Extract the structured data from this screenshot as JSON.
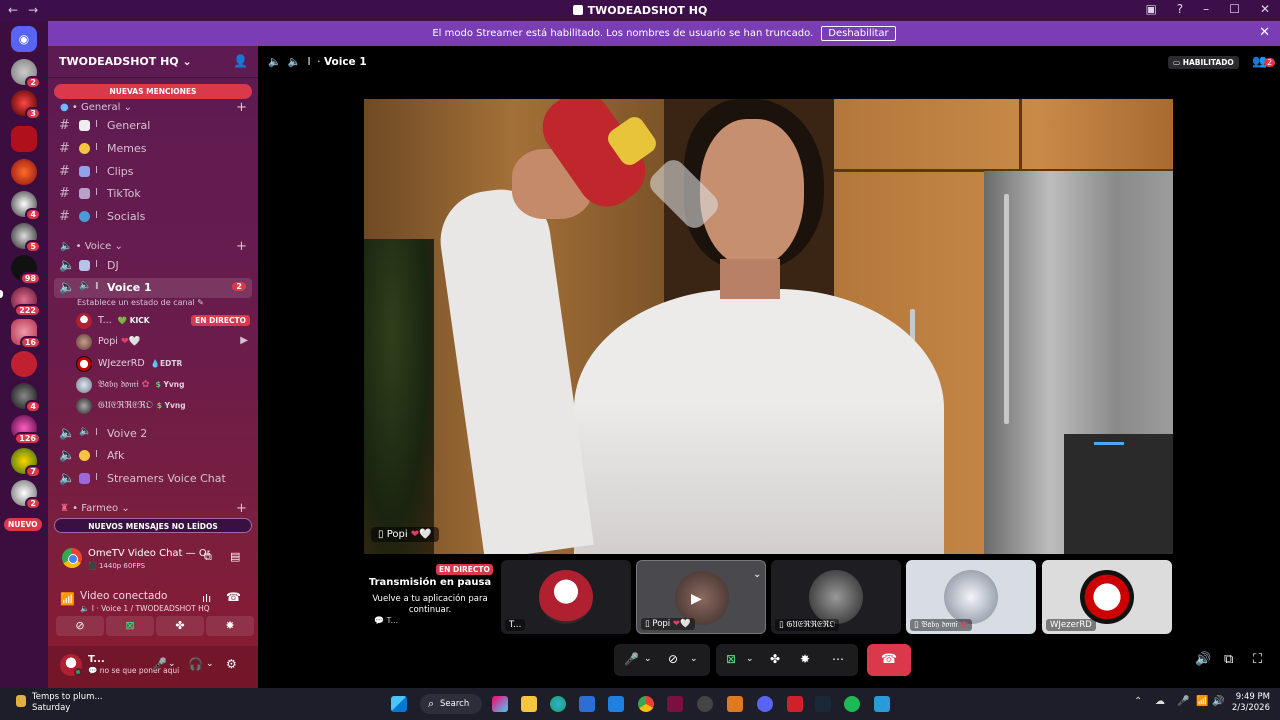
{
  "window": {
    "title": "TWODEADSHOT HQ"
  },
  "banner": {
    "text": "El modo Streamer está habilitado. Los nombres de usuario se han truncado.",
    "button": "Deshabilitar"
  },
  "rail": {
    "badges": [
      "2",
      "3",
      "4",
      "5",
      "98",
      "222",
      "16",
      "4",
      "126",
      "7",
      "2"
    ],
    "new_label": "NUEVO"
  },
  "server": {
    "name": "TWODEADSHOT HQ",
    "new_mentions": "NUEVAS MENCIONES",
    "new_messages": "NUEVOS MENSAJES NO LEÍDOS",
    "categories": {
      "general": "• General",
      "voice": "• Voice",
      "farmeo": "• Farmeo"
    },
    "text_channels": [
      "General",
      "Memes",
      "Clips",
      "TikTok",
      "Socials"
    ],
    "voice_channels": {
      "dj": "DJ",
      "voice1": "Voice 1",
      "voice1_count": "2",
      "voive2": "Voive 2",
      "afk": "Afk",
      "streamers": "Streamers Voice Chat"
    },
    "status_hint": "Establece un estado de canal",
    "voice_users": [
      {
        "name": "T...",
        "tag": "KICK",
        "badge": "EN DIRECTO"
      },
      {
        "name": "Popi",
        "tag": ""
      },
      {
        "name": "WJezerRD",
        "tag": "EDTR"
      },
      {
        "name": "𝔅𝔞𝔟𝔶 𝔡𝔬𝔪𝔦",
        "tag": "Yvng"
      },
      {
        "name": "𝔊𝔘𝔈ℜℜ𝔈ℜ𝔒",
        "tag": "Yvng"
      }
    ]
  },
  "activity": {
    "title": "OmeTV Video Chat — Omegle R...",
    "quality": "1440p 60FPS"
  },
  "voice_panel": {
    "status": "Video conectado",
    "location": "Voice 1 / TWODEADSHOT HQ"
  },
  "user": {
    "name": "T...",
    "status": "no se que poner aqui"
  },
  "main": {
    "channel": "Voice 1",
    "streamer_badge": "HABILITADO",
    "people_count": "2",
    "video_label": "Popi",
    "paused": {
      "live": "EN DIRECTO",
      "title": "Transmisión en pausa",
      "subtitle": "Vuelve a tu aplicación para continuar.",
      "user": "T..."
    },
    "tiles": [
      {
        "label": "T..."
      },
      {
        "label": "Popi"
      },
      {
        "label": "𝔊𝔘𝔈ℜℜ𝔈ℜ𝔒"
      },
      {
        "label": "𝔅𝔞𝔟𝔶 𝔡𝔬𝔪𝔦"
      },
      {
        "label": "WJezerRD"
      }
    ]
  },
  "taskbar": {
    "weather_title": "Temps to plum...",
    "weather_sub": "Saturday",
    "search": "Search",
    "time": "9:49 PM",
    "date": "2/3/2026"
  },
  "colors": {
    "accent": "#d9394a",
    "banner": "#7a3db3",
    "titlebar": "#3d0f4a"
  }
}
